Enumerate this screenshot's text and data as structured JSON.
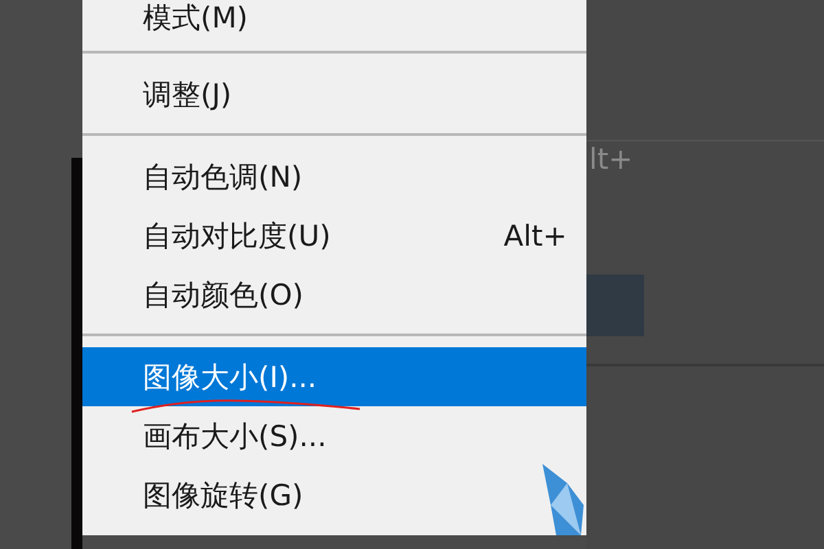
{
  "menu": {
    "items": [
      {
        "kind": "item",
        "label": "模式(M)",
        "selected": false
      },
      {
        "kind": "separator"
      },
      {
        "kind": "item",
        "label": "调整(J)",
        "selected": false
      },
      {
        "kind": "separator"
      },
      {
        "kind": "item",
        "label": "自动色调(N)",
        "selected": false
      },
      {
        "kind": "item",
        "label": "自动对比度(U)",
        "shortcut": "Alt+",
        "selected": false
      },
      {
        "kind": "item",
        "label": "自动颜色(O)",
        "selected": false
      },
      {
        "kind": "separator"
      },
      {
        "kind": "item",
        "label": "图像大小(I)...",
        "selected": true
      },
      {
        "kind": "item",
        "label": "画布大小(S)...",
        "selected": false
      },
      {
        "kind": "item",
        "label": "图像旋转(G)",
        "selected": false
      }
    ]
  },
  "background_panel": {
    "text": "lt+"
  }
}
